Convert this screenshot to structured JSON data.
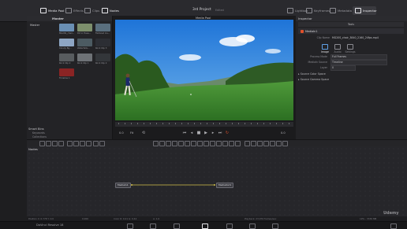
{
  "topbar": {
    "media_pool": "Media Pool",
    "effects": "Effects",
    "clips": "Clips",
    "nodes": "Nodes",
    "project_title": "3rd Project",
    "project_status": "Edited",
    "lightbox": "Lightbox",
    "keyframes": "Keyframes",
    "metadata": "Metadata",
    "inspector": "Inspector"
  },
  "media_pool": {
    "title": "Master",
    "master_bin": "Master",
    "smart_bins_title": "Smart Bins",
    "smart_bins": [
      "Keywords",
      "Collections"
    ],
    "clips": [
      {
        "name": "MG20S_chair...",
        "color": "#6a8fb4"
      },
      {
        "name": "Pot in Trees...",
        "color": "#7d8f6c"
      },
      {
        "name": "Fishbowl Ice...",
        "color": "#5a6f7e"
      },
      {
        "name": "Cloudy Bg...",
        "color": "#8ea6c4"
      },
      {
        "name": "Waterfalls...",
        "color": "#4c5b62"
      },
      {
        "name": "Rock Clip 3",
        "color": "#2c2e34"
      },
      {
        "name": "Rock Clip 2",
        "color": "#585c5f"
      },
      {
        "name": "Rock Clip 1",
        "color": "#6e7276"
      },
      {
        "name": "Rock Clip 2",
        "color": "#33363a"
      },
      {
        "name": "Timeline 1",
        "color": "#8a2424"
      }
    ]
  },
  "viewer": {
    "title": "Media Pool",
    "timecode_left": "0.0",
    "zoom": "Fit",
    "timecode_right": "0.0"
  },
  "inspector": {
    "title": "Inspector",
    "tools": "Tools",
    "clip_name": "MediaIn1",
    "file_label": "Clip Name",
    "file_name": "MG20S_chair_3840_2160_24fps.mp4",
    "tabs": [
      "Image",
      "Audio",
      "Settings"
    ],
    "fields": [
      {
        "label": "Process Mode",
        "value": "Full Frames"
      },
      {
        "label": "MediaIn Source",
        "value": "Timeline"
      },
      {
        "label": "Layer",
        "value": "0"
      }
    ],
    "sections": [
      "Source Color Space",
      "Source Gamma Space"
    ]
  },
  "nodes": {
    "title": "Nodes",
    "node1": "MediaIn1",
    "node2": "MediaOut1"
  },
  "status": {
    "position": "Position  X: 0.778  Y: 0.0",
    "zoom": "0.000",
    "color": "Color  R: 0.21  G: 0.44",
    "alpha": "A: 1.0",
    "playback": "Playback: 23.976 frames/sec",
    "mem": "19% - 3330 MB"
  },
  "page": {
    "app_name": "DaVinci Resolve 18"
  },
  "watermark": "Udemy",
  "colors": {
    "accent": "#e0502a",
    "selection": "#5fa0e6",
    "connection": "#d4c24a"
  }
}
